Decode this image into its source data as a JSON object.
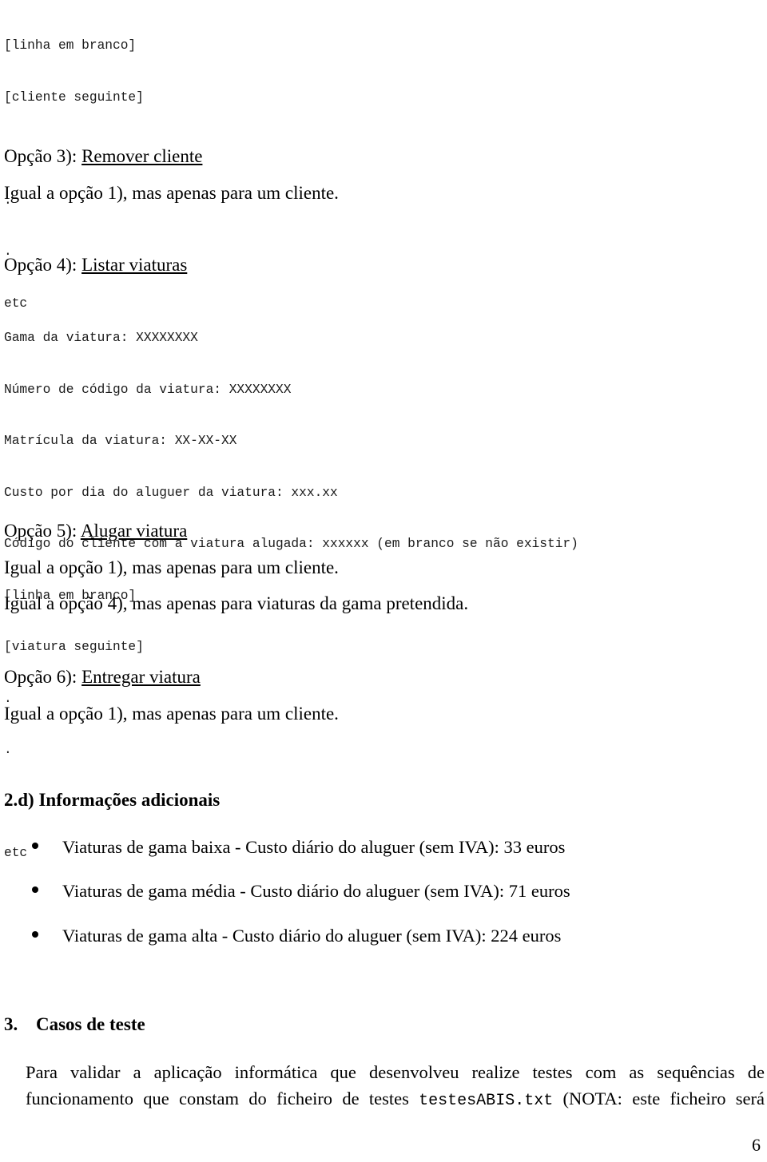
{
  "document": {
    "page_number": "6"
  },
  "top_listing": {
    "lines": [
      "[linha em branco]",
      "[cliente seguinte]",
      ".",
      ".",
      ".",
      "etc"
    ]
  },
  "option3": {
    "label": "Opção 3): ",
    "title": "Remover cliente",
    "body": "Igual a opção 1), mas apenas para um cliente."
  },
  "option4": {
    "label": "Opção 4): ",
    "title": "Listar viaturas",
    "listing": {
      "lines": [
        "Gama da viatura: XXXXXXXX",
        "Número de código da viatura: XXXXXXXX",
        "Matrícula da viatura: XX-XX-XX",
        "Custo por dia do aluguer da viatura: xxx.xx",
        "Código do cliente com a viatura alugada: xxxxxx (em branco se não existir)",
        "[linha em branco]",
        "[viatura seguinte]",
        ".",
        ".",
        ".",
        "etc"
      ]
    }
  },
  "option5": {
    "label": "Opção 5): ",
    "title": "Alugar viatura",
    "body1": "Igual a opção 1), mas apenas para um cliente.",
    "body2": "Igual a opção 4), mas apenas para viaturas da gama pretendida."
  },
  "option6": {
    "label": "Opção 6): ",
    "title": "Entregar viatura",
    "body1": "Igual a opção 1), mas apenas para um cliente."
  },
  "section_2d": {
    "heading": "2.d) Informações adicionais",
    "bullets": [
      "Viaturas de gama baixa - Custo diário do aluguer (sem IVA): 33 euros",
      "Viaturas de gama média - Custo diário do aluguer (sem IVA): 71 euros",
      "Viaturas de gama alta - Custo diário do aluguer (sem IVA): 224 euros"
    ]
  },
  "section_3": {
    "number": "3.",
    "heading": "Casos de teste",
    "paragraph_part1": "Para validar a aplicação informática que desenvolveu realize testes com as sequências de funcionamento que constam do ficheiro de testes ",
    "paragraph_mono": "testesABIS.txt",
    "paragraph_part2": " (NOTA: este ficheiro será"
  }
}
